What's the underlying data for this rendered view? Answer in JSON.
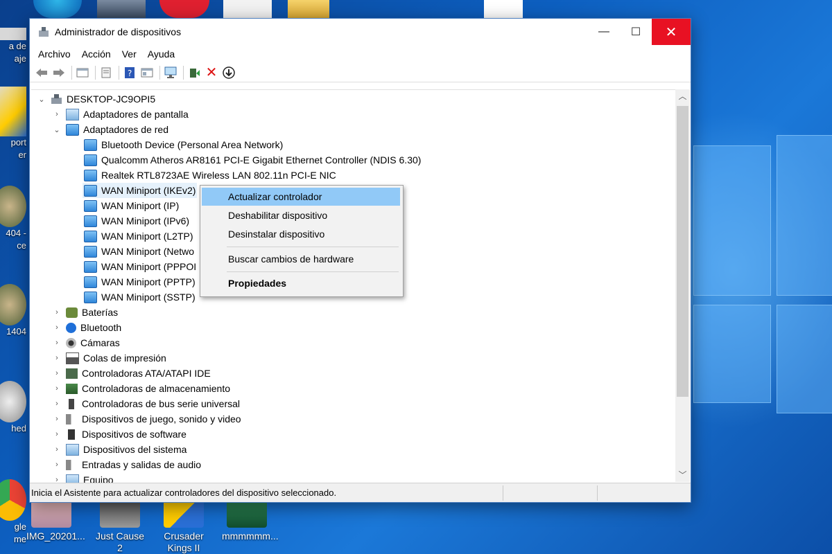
{
  "window": {
    "title": "Administrador de dispositivos",
    "minimize": "—",
    "maximize": "☐",
    "close": "✕"
  },
  "menu": [
    "Archivo",
    "Acción",
    "Ver",
    "Ayuda"
  ],
  "toolbar": {
    "icons": [
      "back-icon",
      "forward-icon",
      "properties-icon",
      "show-hide-icon",
      "help-icon",
      "view-icon",
      "monitor-icon",
      "update-driver-icon",
      "uninstall-icon",
      "download-icon"
    ]
  },
  "tree": {
    "root": "DESKTOP-JC9OPI5",
    "categories": [
      {
        "label": "Adaptadores de pantalla",
        "expanded": false
      },
      {
        "label": "Adaptadores de red",
        "expanded": true,
        "children": [
          "Bluetooth Device (Personal Area Network)",
          "Qualcomm Atheros AR8161 PCI-E Gigabit Ethernet Controller (NDIS 6.30)",
          "Realtek RTL8723AE Wireless LAN 802.11n PCI-E NIC",
          "WAN Miniport (IKEv2)",
          "WAN Miniport (IP)",
          "WAN Miniport (IPv6)",
          "WAN Miniport (L2TP)",
          "WAN Miniport (Netwo",
          "WAN Miniport (PPPOI",
          "WAN Miniport (PPTP)",
          "WAN Miniport (SSTP)"
        ]
      },
      {
        "label": "Baterías",
        "expanded": false
      },
      {
        "label": "Bluetooth",
        "expanded": false
      },
      {
        "label": "Cámaras",
        "expanded": false
      },
      {
        "label": "Colas de impresión",
        "expanded": false
      },
      {
        "label": "Controladoras ATA/ATAPI IDE",
        "expanded": false
      },
      {
        "label": "Controladoras de almacenamiento",
        "expanded": false
      },
      {
        "label": "Controladoras de bus serie universal",
        "expanded": false
      },
      {
        "label": "Dispositivos de juego, sonido y video",
        "expanded": false
      },
      {
        "label": "Dispositivos de software",
        "expanded": false
      },
      {
        "label": "Dispositivos del sistema",
        "expanded": false
      },
      {
        "label": "Entradas y salidas de audio",
        "expanded": false
      },
      {
        "label": "Equipo",
        "expanded": false
      }
    ]
  },
  "context_menu": {
    "items": [
      "Actualizar controlador",
      "Deshabilitar dispositivo",
      "Desinstalar dispositivo",
      "Buscar cambios de hardware",
      "Propiedades"
    ],
    "highlighted": "Actualizar controlador"
  },
  "status": "Inicia el Asistente para actualizar controladores del dispositivo seleccionado.",
  "desktop": {
    "bottom_icons": [
      "IMG_20201...",
      "Just Cause 2",
      "Crusader Kings II",
      "mmmmmm..."
    ],
    "left_labels": [
      "a de",
      "aje",
      "port",
      "er",
      "404 -",
      "ce",
      "1404",
      "hed",
      "gle",
      "me"
    ]
  }
}
